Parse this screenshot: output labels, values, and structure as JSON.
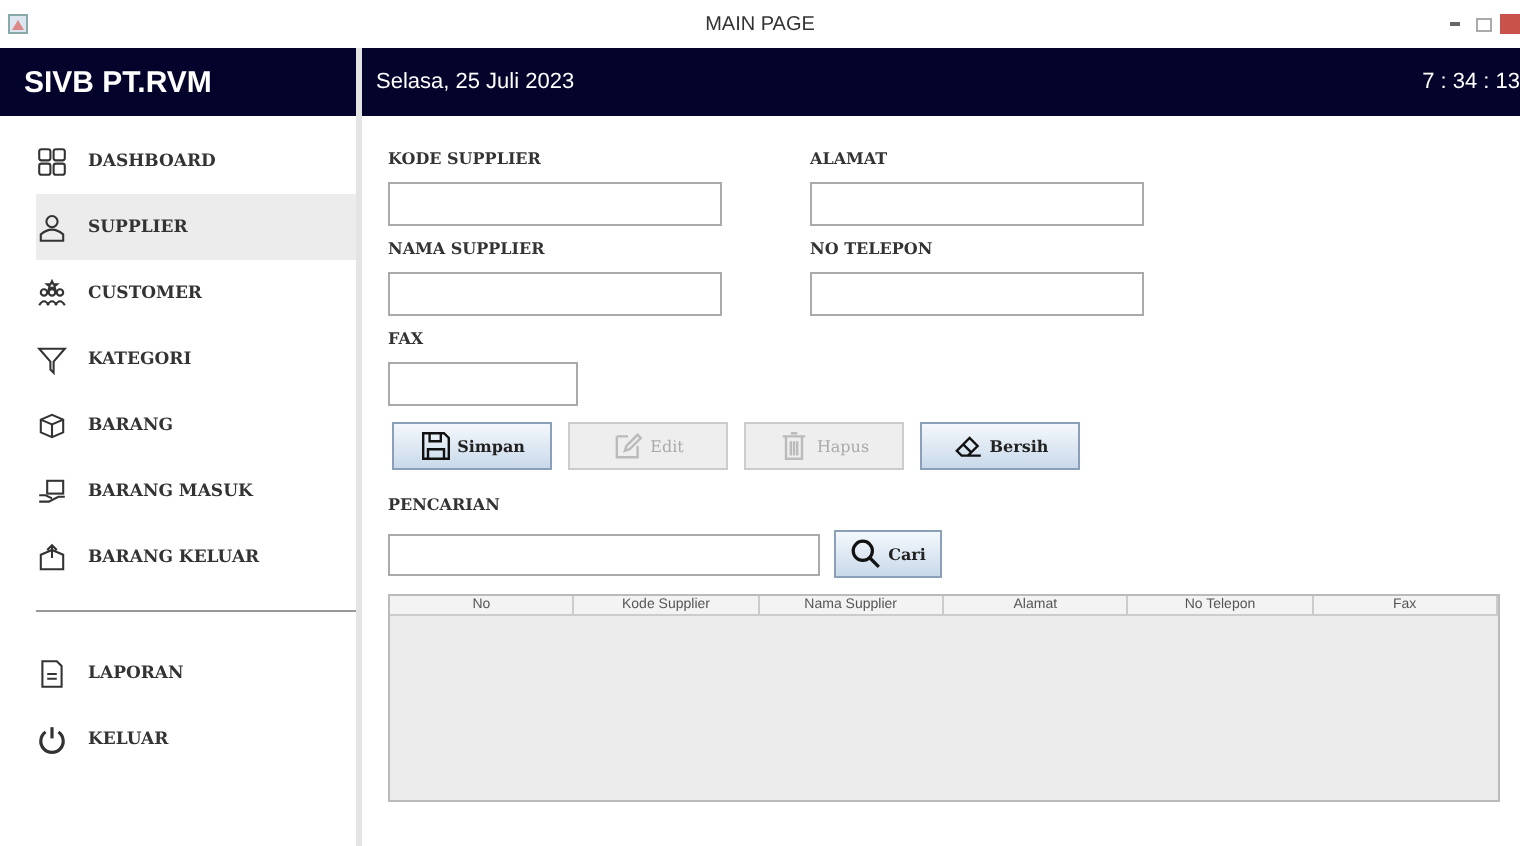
{
  "window": {
    "title": "MAIN PAGE"
  },
  "header": {
    "app_name": "SIVB PT.RVM",
    "date": "Selasa, 25 Juli 2023",
    "time": "7 : 34 : 13"
  },
  "sidebar": {
    "items": [
      {
        "label": "DASHBOARD",
        "selected": false
      },
      {
        "label": "SUPPLIER",
        "selected": true
      },
      {
        "label": "CUSTOMER",
        "selected": false
      },
      {
        "label": "KATEGORI",
        "selected": false
      },
      {
        "label": "BARANG",
        "selected": false
      },
      {
        "label": "BARANG MASUK",
        "selected": false
      },
      {
        "label": "BARANG KELUAR",
        "selected": false
      }
    ],
    "bottom_items": [
      {
        "label": "LAPORAN",
        "selected": false
      },
      {
        "label": "KELUAR",
        "selected": false
      }
    ]
  },
  "form": {
    "fields": [
      {
        "label": "KODE SUPPLIER"
      },
      {
        "label": "ALAMAT"
      },
      {
        "label": "NAMA SUPPLIER"
      },
      {
        "label": "NO TELEPON"
      },
      {
        "label": "FAX"
      }
    ],
    "buttons": [
      {
        "label": "Simpan",
        "disabled": false
      },
      {
        "label": "Edit",
        "disabled": true
      },
      {
        "label": "Hapus",
        "disabled": true
      },
      {
        "label": "Bersih",
        "disabled": false
      }
    ],
    "search": {
      "label": "PENCARIAN",
      "button": "Cari"
    }
  },
  "table": {
    "columns": [
      "No",
      "Kode Supplier",
      "Nama Supplier",
      "Alamat",
      "No Telepon",
      "Fax"
    ]
  }
}
